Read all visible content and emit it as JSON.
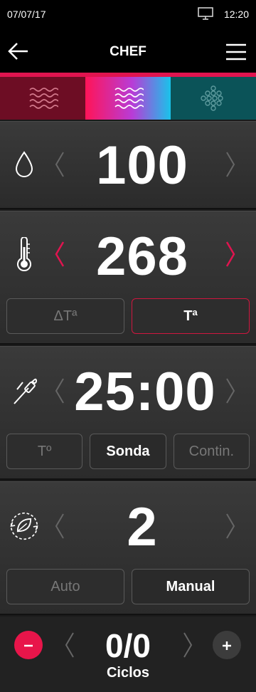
{
  "status": {
    "date": "07/07/17",
    "time": "12:20"
  },
  "header": {
    "title": "CHEF"
  },
  "modes": [
    {
      "name": "convection",
      "active": false
    },
    {
      "name": "combi",
      "active": true
    },
    {
      "name": "steam",
      "active": false
    }
  ],
  "humidity": {
    "value": "100"
  },
  "temperature": {
    "value": "268",
    "options": [
      "ΔTª",
      "Tª"
    ],
    "selected": "Tª"
  },
  "time": {
    "value": "25:00",
    "options": [
      "Tº",
      "Sonda",
      "Contin."
    ],
    "selected": "Sonda"
  },
  "cycles": {
    "value": "2",
    "options": [
      "Auto",
      "Manual"
    ],
    "selected": "Manual"
  },
  "counter": {
    "value": "0/0",
    "label": "Ciclos"
  },
  "colors": {
    "accent": "#e0144f",
    "background": "#1a1a1a",
    "panel": "#333333"
  }
}
